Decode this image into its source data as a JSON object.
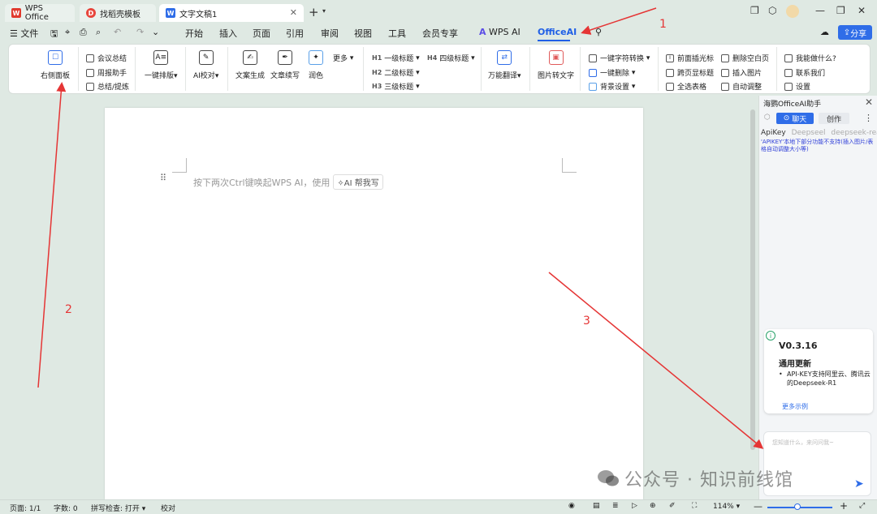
{
  "titlebar": {
    "tabs": [
      {
        "label": "WPS Office",
        "icon": "wps-logo-icon"
      },
      {
        "label": "找稻壳模板",
        "icon": "docer-icon"
      },
      {
        "label": "文字文稿1",
        "icon": "word-doc-icon"
      }
    ]
  },
  "menu": {
    "file": "文件",
    "items": [
      "开始",
      "插入",
      "页面",
      "引用",
      "审阅",
      "视图",
      "工具",
      "会员专享",
      "WPS AI",
      "OfficeAI"
    ],
    "share": "分享"
  },
  "ribbon": {
    "right_panel": "右侧面板",
    "meeting": "会议总结",
    "weekly": "周报助手",
    "summary": "总结/提炼",
    "layout": "一键排版",
    "ai_check": "AI校对",
    "gen": "文案生成",
    "continue": "文章续写",
    "polish": "润色",
    "more": "更多",
    "h1": "一级标题",
    "h2": "二级标题",
    "h3": "三级标题",
    "h4": "四级标题",
    "translate": "万能翻译",
    "img2text": "图片转文字",
    "convert": "一键字符转换",
    "delete": "一键删除",
    "bg": "背景设置",
    "insert_mark": "前面插光标",
    "cross_page": "跨页显标题",
    "select_table": "全选表格",
    "del_blank": "删除空白页",
    "insert_img": "插入图片",
    "auto_adjust": "自动调整",
    "what_can": "我能做什么?",
    "contact": "联系我们",
    "settings": "设置"
  },
  "document": {
    "prompt": "按下两次Ctrl键唤起WPS AI，使用",
    "ai_help": "AI 帮我写"
  },
  "panel": {
    "title": "海鹦OfficeAI助手",
    "tab_chat": "聊天",
    "tab_create": "创作",
    "apikey_label": "ApiKey",
    "model1": "Deepseel",
    "model2": "deepseek-reaso",
    "notice": "'APIKEY'本地下部分功能不支持(插入图片/表格自动调整大小等)",
    "version": "V0.3.16",
    "update_title": "通用更新",
    "update_body": "API-KEY支持阿里云、腾讯云的Deepseek-R1",
    "more_examples": "更多示例",
    "input_placeholder": "您知道什么，来问问我~"
  },
  "status": {
    "page": "页面: 1/1",
    "words": "字数: 0",
    "spell": "拼写检查: 打开",
    "proof": "校对",
    "zoom": "114%"
  },
  "watermark": "公众号 · 知识前线馆",
  "annotations": [
    "1",
    "2",
    "3"
  ],
  "colors": {
    "accent": "#1f5fe6",
    "annotation": "#e53535"
  }
}
